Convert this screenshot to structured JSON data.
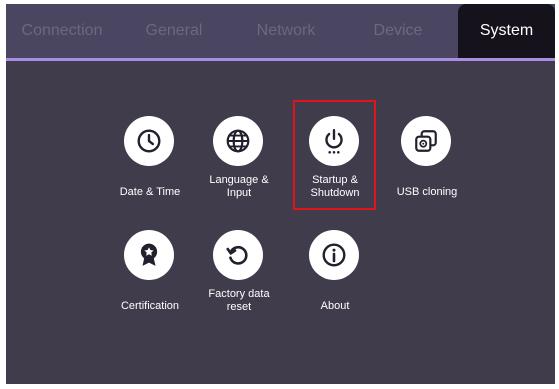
{
  "tabs": [
    {
      "label": "Connection",
      "active": false
    },
    {
      "label": "General",
      "active": false
    },
    {
      "label": "Network",
      "active": false
    },
    {
      "label": "Device",
      "active": false
    },
    {
      "label": "System",
      "active": true
    }
  ],
  "items": [
    {
      "label": "Date & Time",
      "icon": "clock-icon"
    },
    {
      "label": "Language &\nInput",
      "icon": "globe-icon"
    },
    {
      "label": "Startup &\nShutdown",
      "icon": "power-icon",
      "selected": true
    },
    {
      "label": "USB cloning",
      "icon": "layers-gear-icon"
    },
    {
      "label": "Certification",
      "icon": "award-ribbon-icon"
    },
    {
      "label": "Factory data\nreset",
      "icon": "restore-icon"
    },
    {
      "label": "About",
      "icon": "info-icon"
    }
  ],
  "colors": {
    "background": "#403c4c",
    "tabbar": "#4a4560",
    "active_tab": "#15121b",
    "accent_line": "#a98ce3",
    "selection_border": "#e0141b",
    "icon_fill": "#231f2c"
  }
}
